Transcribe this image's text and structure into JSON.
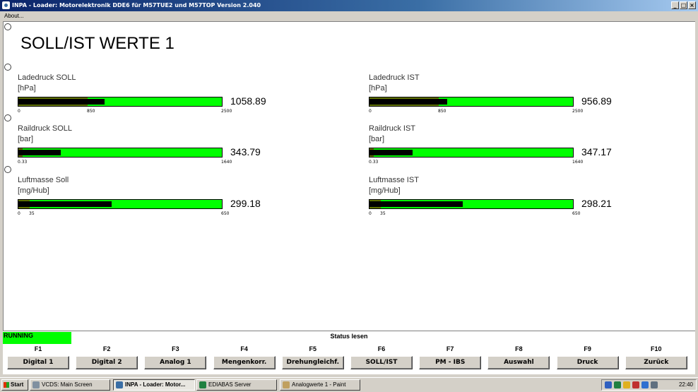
{
  "window": {
    "title": "INPA - Loader: Motorelektronik DDE6 für M57TUE2 und M57TOP Version 2.040",
    "buttons": [
      "_",
      "□",
      "×"
    ]
  },
  "menu": {
    "about": "About..."
  },
  "screen": {
    "heading": "SOLL/IST WERTE 1"
  },
  "gauges": [
    {
      "label": "Ladedruck SOLL",
      "unit": "[hPa]",
      "value": "1058.89",
      "fill": 0.4236,
      "red": 0.34,
      "ticks": [
        "0",
        "850",
        "2500"
      ],
      "tick_pos": [
        0,
        0.34,
        1
      ]
    },
    {
      "label": "Ladedruck IST",
      "unit": "[hPa]",
      "value": "956.89",
      "fill": 0.3828,
      "red": 0.34,
      "ticks": [
        "0",
        "850",
        "2500"
      ],
      "tick_pos": [
        0,
        0.34,
        1
      ]
    },
    {
      "label": "Raildruck SOLL",
      "unit": "[bar]",
      "value": "343.79",
      "fill": 0.21,
      "red": 0.02,
      "ticks": [
        "0.33",
        "1640"
      ],
      "tick_pos": [
        0,
        1
      ]
    },
    {
      "label": "Raildruck IST",
      "unit": "[bar]",
      "value": "347.17",
      "fill": 0.212,
      "red": 0.02,
      "ticks": [
        "0.33",
        "1640"
      ],
      "tick_pos": [
        0,
        1
      ]
    },
    {
      "label": "Luftmasse Soll",
      "unit": "[mg/Hub]",
      "value": "299.18",
      "fill": 0.46,
      "red": 0.054,
      "ticks": [
        "0",
        "35",
        "650"
      ],
      "tick_pos": [
        0,
        0.054,
        1
      ]
    },
    {
      "label": "Luftmasse IST",
      "unit": "[mg/Hub]",
      "value": "298.21",
      "fill": 0.4588,
      "red": 0.054,
      "ticks": [
        "0",
        "35",
        "650"
      ],
      "tick_pos": [
        0,
        0.054,
        1
      ]
    }
  ],
  "status": {
    "state": "RUNNING",
    "text": "Status lesen"
  },
  "fkeys": [
    {
      "key": "F1",
      "label": "Digital 1"
    },
    {
      "key": "F2",
      "label": "Digital 2"
    },
    {
      "key": "F3",
      "label": "Analog 1"
    },
    {
      "key": "F4",
      "label": "Mengenkorr."
    },
    {
      "key": "F5",
      "label": "Drehungleichf."
    },
    {
      "key": "F6",
      "label": "SOLL/IST"
    },
    {
      "key": "F7",
      "label": "PM - IBS"
    },
    {
      "key": "F8",
      "label": "Auswahl"
    },
    {
      "key": "F9",
      "label": "Druck"
    },
    {
      "key": "F10",
      "label": "Zurück"
    }
  ],
  "taskbar": {
    "start": "Start",
    "tasks": [
      {
        "label": "VCDS:  Main Screen",
        "active": false,
        "color": "#8090a0"
      },
      {
        "label": "INPA - Loader: Motor...",
        "active": true,
        "color": "#3a6ea5"
      },
      {
        "label": "EDIABAS Server",
        "active": false,
        "color": "#208040"
      },
      {
        "label": "Analogwerte 1 - Paint",
        "active": false,
        "color": "#c0a060"
      }
    ],
    "clock": "22:40",
    "tray_icons": [
      "language-de-icon",
      "network-icon",
      "security-icon",
      "shield-icon",
      "update-icon",
      "monitor-icon"
    ]
  }
}
